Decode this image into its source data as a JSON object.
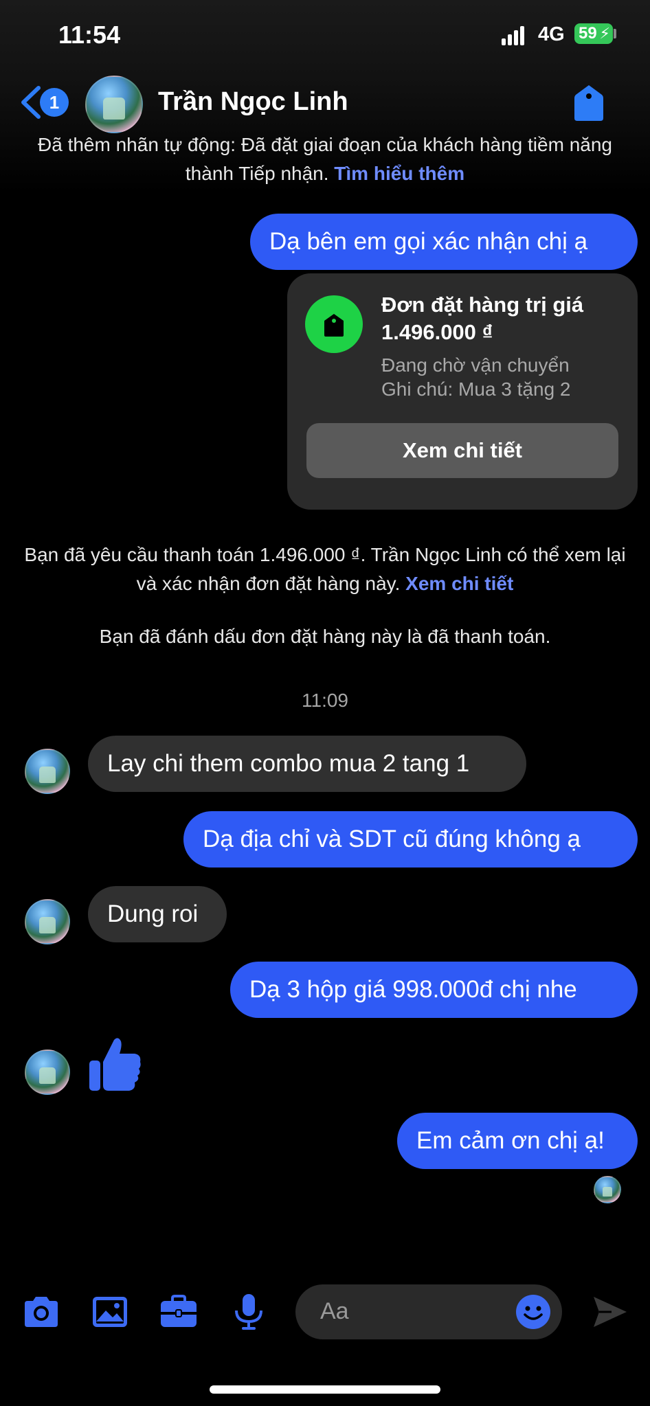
{
  "status_bar": {
    "time": "11:54",
    "network": "4G",
    "battery": "59"
  },
  "header": {
    "back_badge": "1",
    "contact_name": "Trần Ngọc Linh"
  },
  "system_notice": {
    "text": "Đã thêm nhãn tự động: Đã đặt giai đoạn của khách hàng tiềm năng thành Tiếp nhận.",
    "link": "Tìm hiểu thêm"
  },
  "messages": {
    "m1": "Dạ bên em gọi xác nhận chị ạ",
    "m2": "Lay chi them combo mua 2 tang 1",
    "m3": "Dạ địa chỉ và SDT cũ đúng không ạ",
    "m4": "Dung roi",
    "m5": "Dạ 3 hộp giá 998.000đ chị nhe",
    "m6": "Em cảm ơn chị ạ!"
  },
  "order_card": {
    "title": "Đơn đặt hàng trị giá 1.496.000 ₫",
    "status": "Đang chờ vận chuyển",
    "note": "Ghi chú: Mua 3 tặng 2",
    "button": "Xem chi tiết"
  },
  "payment_notice": {
    "text": "Bạn đã yêu cầu thanh toán 1.496.000 ₫. Trần Ngọc Linh có thể xem lại và xác nhận đơn đặt hàng này.",
    "link": "Xem chi tiết"
  },
  "paid_notice": "Bạn đã đánh dấu đơn đặt hàng này là đã thanh toán.",
  "timestamp": "11:09",
  "composer": {
    "placeholder": "Aa"
  },
  "colors": {
    "accent": "#2f5af5",
    "link": "#6f8cff",
    "incoming": "#303030",
    "order_icon": "#1ed246"
  },
  "icons": [
    "back-chevron-icon",
    "tag-icon",
    "thumbs-up-icon",
    "camera-icon",
    "image-icon",
    "briefcase-icon",
    "microphone-icon",
    "smile-icon",
    "send-icon"
  ]
}
